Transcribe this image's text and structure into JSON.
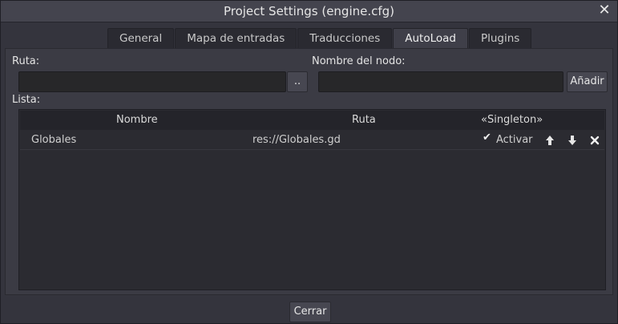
{
  "window": {
    "title": "Project Settings (engine.cfg)"
  },
  "tabs": [
    {
      "label": "General"
    },
    {
      "label": "Mapa de entradas"
    },
    {
      "label": "Traducciones"
    },
    {
      "label": "AutoLoad",
      "active": true
    },
    {
      "label": "Plugins"
    }
  ],
  "form": {
    "path_label": "Ruta:",
    "path_value": "",
    "browse_label": "..",
    "node_name_label": "Nombre del nodo:",
    "node_name_value": "",
    "add_label": "Añadir",
    "list_label": "Lista:"
  },
  "list": {
    "columns": [
      "Nombre",
      "Ruta",
      "«Singleton»"
    ],
    "rows": [
      {
        "name": "Globales",
        "path": "res://Globales.gd",
        "singleton_checked": true,
        "singleton_label": "Activar"
      }
    ]
  },
  "footer": {
    "close_label": "Cerrar"
  },
  "icons": [
    "close-icon",
    "arrow-up-icon",
    "arrow-down-icon",
    "remove-icon",
    "checkmark-icon"
  ]
}
